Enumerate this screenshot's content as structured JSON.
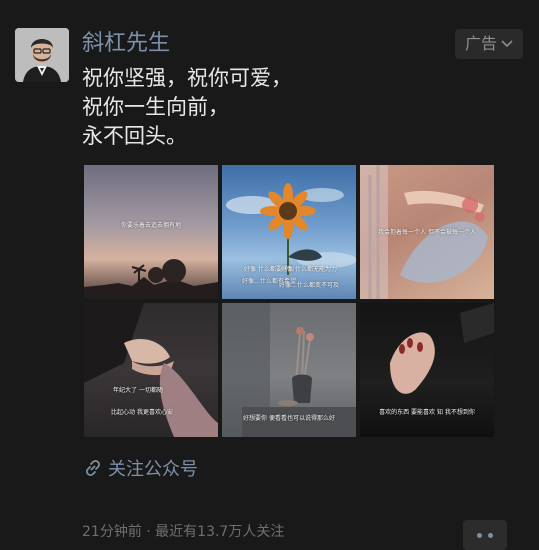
{
  "post": {
    "author": "斜杠先生",
    "ad_label": "广告",
    "text_lines": [
      "祝你坚强，祝你可爱，",
      "祝你一生向前，",
      "永不回头。"
    ],
    "images": [
      {
        "captions": [
          "你要乐着去追去拥有地"
        ]
      },
      {
        "captions": [
          "好像 什么都要得到",
          "好像 什么都无能为力",
          "好像…什么都有希望",
          "好像…什么都变不可及"
        ]
      },
      {
        "captions": [
          "我会抱着每一个人 但不会被每一个人"
        ]
      },
      {
        "captions": [
          "年纪大了 一切都随",
          "比起心动 我更喜欢心安"
        ]
      },
      {
        "captions": [
          "好想要你 便看看也可以说得那么好"
        ]
      },
      {
        "captions": [
          "喜欢的东西 要能喜欢 知 我不想到你"
        ]
      }
    ],
    "link_text": "关注公众号",
    "footer": "21分钟前 · 最近有13.7万人关注"
  },
  "colors": {
    "background": "#191919",
    "author": "#7d90a9",
    "text": "#e8e8e8",
    "muted": "#6f6f6f"
  }
}
